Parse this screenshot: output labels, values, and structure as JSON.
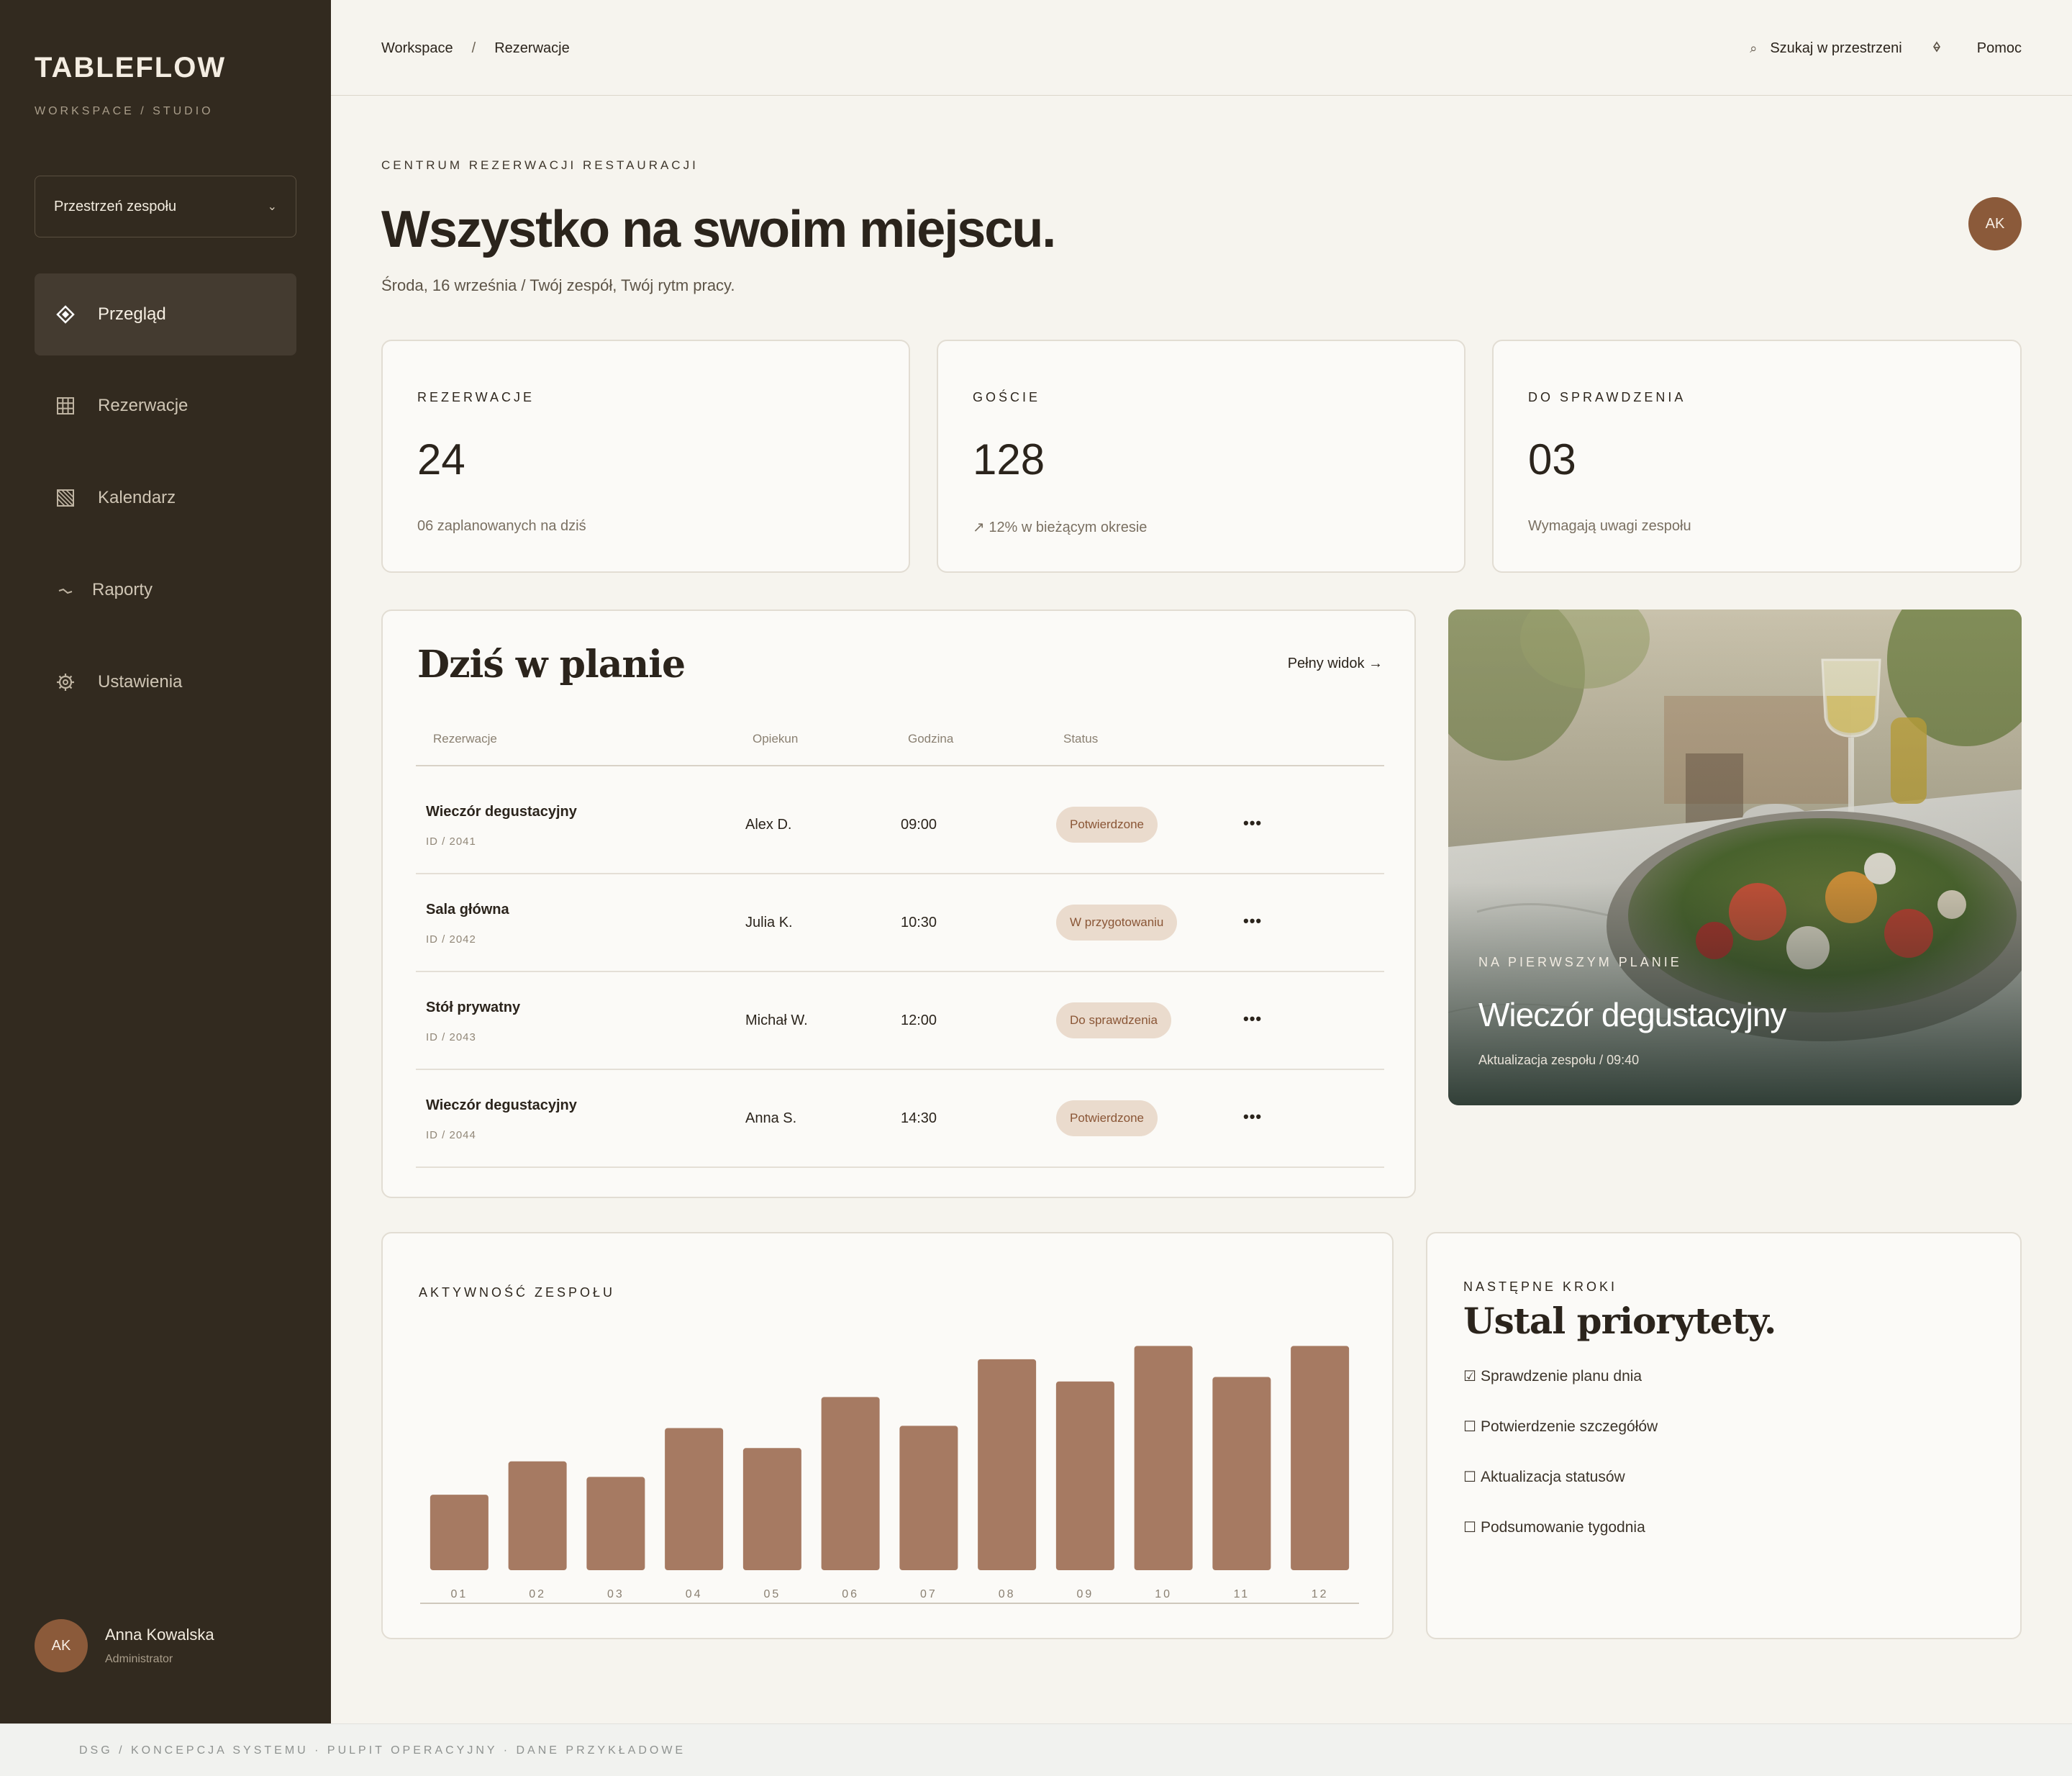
{
  "sidebar": {
    "brand": "TABLEFLOW",
    "brand_sub": "WORKSPACE / STUDIO",
    "workspace_select": "Przestrzeń zespołu",
    "items": [
      {
        "label": "Przegląd",
        "icon": "diamond-icon",
        "active": true
      },
      {
        "label": "Rezerwacje",
        "icon": "grid-icon",
        "active": false
      },
      {
        "label": "Kalendarz",
        "icon": "calendar-icon",
        "active": false
      },
      {
        "label": "Raporty",
        "icon": "trend-icon",
        "active": false
      },
      {
        "label": "Ustawienia",
        "icon": "gear-icon",
        "active": false
      }
    ],
    "user": {
      "initials": "AK",
      "name": "Anna Kowalska",
      "role": "Administrator"
    }
  },
  "topbar": {
    "crumbs": [
      "Workspace",
      "Rezerwacje"
    ],
    "crumb_sep": "/",
    "search_label": "Szukaj w przestrzeni",
    "help_label": "Pomoc"
  },
  "hero": {
    "eyebrow": "CENTRUM REZERWACJI RESTAURACJI",
    "title": "Wszystko na swoim miejscu.",
    "subtitle": "Środa, 16 września / Twój zespół, Twój rytm pracy.",
    "avatar": "AK"
  },
  "stats": [
    {
      "label": "REZERWACJE",
      "value": "24",
      "note": "06 zaplanowanych na dziś"
    },
    {
      "label": "GOŚCIE",
      "value": "128",
      "note": "↗ 12% w bieżącym okresie"
    },
    {
      "label": "DO SPRAWDZENIA",
      "value": "03",
      "note": "Wymagają uwagi zespołu"
    }
  ],
  "plan": {
    "title": "Dziś w planie",
    "full_view": "Pełny widok →",
    "columns": [
      "Rezerwacje",
      "Opiekun",
      "Godzina",
      "Status"
    ],
    "rows": [
      {
        "name": "Wieczór degustacyjny",
        "id": "ID / 2041",
        "owner": "Alex D.",
        "time": "09:00",
        "status": "Potwierdzone"
      },
      {
        "name": "Sala główna",
        "id": "ID / 2042",
        "owner": "Julia K.",
        "time": "10:30",
        "status": "W przygotowaniu"
      },
      {
        "name": "Stół prywatny",
        "id": "ID / 2043",
        "owner": "Michał W.",
        "time": "12:00",
        "status": "Do sprawdzenia"
      },
      {
        "name": "Wieczór degustacyjny",
        "id": "ID / 2044",
        "owner": "Anna S.",
        "time": "14:30",
        "status": "Potwierdzone"
      }
    ],
    "more": "•••"
  },
  "feature": {
    "eyebrow": "NA PIERWSZYM PLANIE",
    "title": "Wieczór degustacyjny",
    "note": "Aktualizacja zespołu / 09:40"
  },
  "activity": {
    "label": "AKTYWNOŚĆ ZESPOŁU",
    "bar_color": "#a67a62"
  },
  "chart_data": {
    "type": "bar",
    "title": "",
    "categories": [
      "01",
      "02",
      "03",
      "04",
      "05",
      "06",
      "07",
      "08",
      "09",
      "10",
      "11",
      "12"
    ],
    "values": [
      34,
      49,
      42,
      64,
      55,
      78,
      65,
      95,
      85,
      101,
      87,
      101
    ],
    "ylim": [
      0,
      105
    ],
    "grid": false
  },
  "steps": {
    "eyebrow": "NASTĘPNE KROKI",
    "title": "Ustal priorytety.",
    "items": [
      {
        "box": "☑",
        "label": "Sprawdzenie planu dnia"
      },
      {
        "box": "☐",
        "label": "Potwierdzenie szczegółów"
      },
      {
        "box": "☐",
        "label": "Aktualizacja statusów"
      },
      {
        "box": "☐",
        "label": "Podsumowanie tygodnia"
      }
    ]
  },
  "footer": {
    "text": "DSG / KONCEPCJA SYSTEMU · PULPIT OPERACYJNY · DANE PRZYKŁADOWE"
  }
}
